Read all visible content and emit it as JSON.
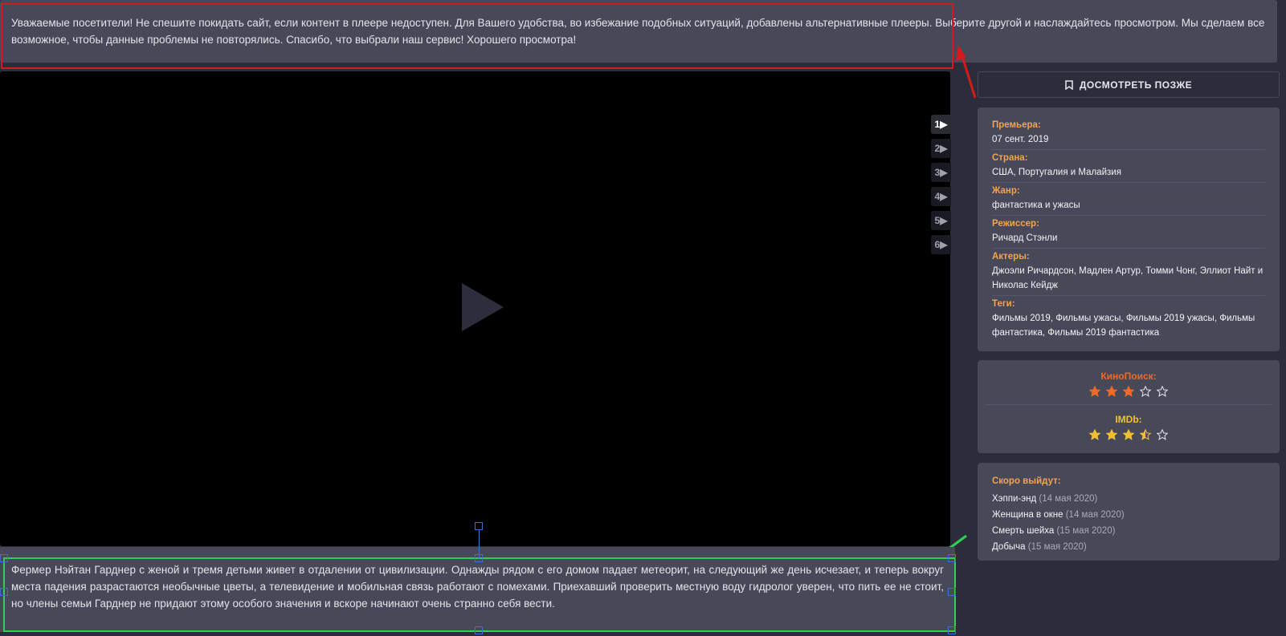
{
  "notice": {
    "text": "Уважаемые посетители! Не спешите покидать сайт, если контент в плеере недоступен. Для Вашего удобства, во избежание подобных ситуаций, добавлены альтернативные плееры. Выберите другой и наслаждайтесь просмотром. Мы сделаем все возможное, чтобы данные проблемы не повторялись. Спасибо, что выбрали наш сервис! Хорошего просмотра!"
  },
  "player": {
    "servers": [
      "1▶",
      "2▶",
      "3▶",
      "4▶",
      "5▶",
      "6▶"
    ],
    "active_server": 0
  },
  "watch_later": {
    "label": "ДОСМОТРЕТЬ ПОЗЖЕ",
    "icon": "bookmark-icon"
  },
  "info": {
    "premiere_label": "Премьера:",
    "premiere_value": "07 сент. 2019",
    "country_label": "Страна:",
    "country_value": "США, Португалия и Малайзия",
    "genre_label": "Жанр:",
    "genre_value": "фантастика и ужасы",
    "director_label": "Режиссер:",
    "director_value": "Ричард Стэнли",
    "actors_label": "Актеры:",
    "actors_value": "Джоэли Ричардсон, Мадлен Артур, Томми Чонг, Эллиот Найт и Николас Кейдж",
    "tags_label": "Теги:",
    "tags_value": "Фильмы 2019, Фильмы ужасы, Фильмы 2019 ужасы, Фильмы фантастика, Фильмы 2019 фантастика"
  },
  "ratings": {
    "kinopoisk_label": "КиноПоиск:",
    "kinopoisk_stars": 3,
    "kinopoisk_color": "#f06a26",
    "imdb_label": "IMDb:",
    "imdb_stars": 3.5,
    "imdb_color": "#f0c030",
    "max_stars": 5
  },
  "soon": {
    "title": "Скоро выйдут:",
    "items": [
      {
        "name": "Хэппи-энд",
        "date": "(14 мая 2020)"
      },
      {
        "name": "Женщина в окне",
        "date": "(14 мая 2020)"
      },
      {
        "name": "Смерть шейха",
        "date": "(15 мая 2020)"
      },
      {
        "name": "Добыча",
        "date": "(15 мая 2020)"
      }
    ]
  },
  "description": {
    "text": "Фермер Нэйтан Гарднер с женой и тремя детьми живет в отдалении от цивилизации. Однажды рядом с его домом падает метеорит, на следующий же день исчезает, и теперь вокруг места падения разрастаются необычные цветы, а телевидение и мобильная связь работают с помехами. Приехавший проверить местную воду гидролог уверен, что пить ее не стоит, но члены семьи Гарднер не придают этому особого значения и вскоре начинают очень странно себя вести."
  },
  "colors": {
    "accent_label": "#f4a254",
    "red_annotation": "#d41b1b",
    "green_annotation": "#2fd153"
  }
}
